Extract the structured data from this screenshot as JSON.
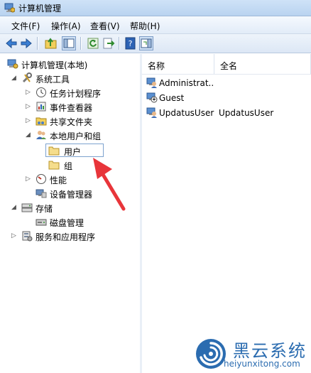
{
  "window": {
    "title": "计算机管理"
  },
  "menu": [
    "文件(F)",
    "操作(A)",
    "查看(V)",
    "帮助(H)"
  ],
  "toolbar": {
    "buttons": [
      "back-arrow-icon",
      "forward-arrow-icon",
      "up-folder-icon",
      "show-hide-tree-icon",
      "refresh-icon",
      "export-list-icon",
      "help-icon",
      "show-hide-action-pane-icon"
    ]
  },
  "tree": {
    "root": "计算机管理(本地)",
    "system_tools": "系统工具",
    "task_scheduler": "任务计划程序",
    "event_viewer": "事件查看器",
    "shared_folders": "共享文件夹",
    "local_users_groups": "本地用户和组",
    "users": "用户",
    "groups": "组",
    "performance": "性能",
    "device_manager": "设备管理器",
    "storage": "存储",
    "disk_management": "磁盘管理",
    "services_apps": "服务和应用程序"
  },
  "list": {
    "columns": [
      "名称",
      "全名"
    ],
    "rows": [
      {
        "name": "Administrat...",
        "fullname": ""
      },
      {
        "name": "Guest",
        "fullname": ""
      },
      {
        "name": "UpdatusUser",
        "fullname": "UpdatusUser"
      }
    ]
  },
  "watermark": {
    "title": "黑云系统",
    "url": "heiyunxitong.com"
  },
  "colors": {
    "accent": "#2b6cb0",
    "arrow": "#e8353a",
    "selection_border": "#7da2ce"
  }
}
